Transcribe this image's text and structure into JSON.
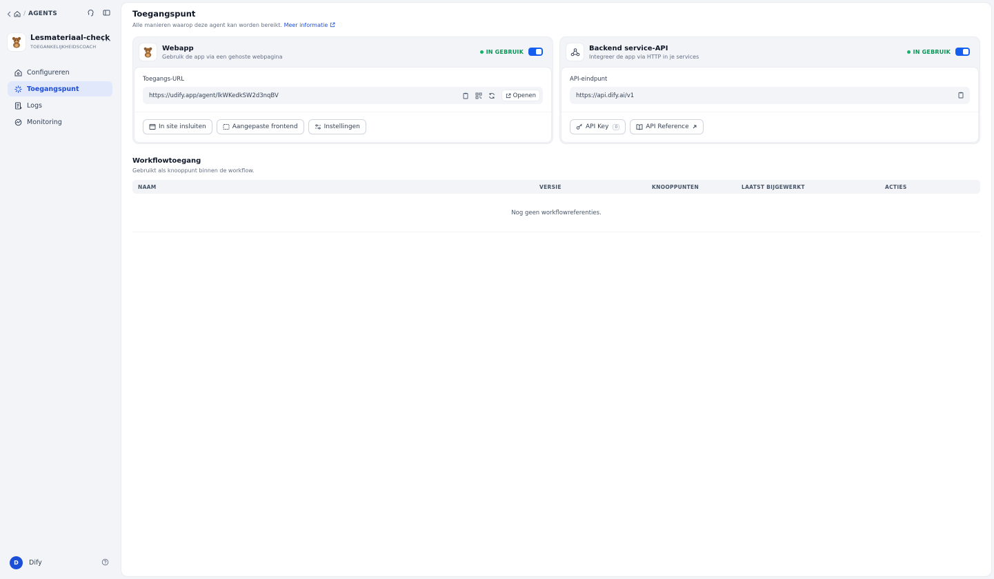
{
  "breadcrumb": {
    "section": "AGENTS"
  },
  "app": {
    "name": "Lesmateriaal-check",
    "subtitle": "TOEGANKELIJKHEIDSCOACH",
    "more": "···"
  },
  "nav": {
    "items": [
      {
        "label": "Configureren",
        "icon": "home-gear-icon"
      },
      {
        "label": "Toegangspunt",
        "icon": "access-point-icon",
        "active": true
      },
      {
        "label": "Logs",
        "icon": "logs-icon"
      },
      {
        "label": "Monitoring",
        "icon": "monitoring-icon"
      }
    ]
  },
  "user": {
    "initial": "D",
    "name": "Dify"
  },
  "page": {
    "title": "Toegangspunt",
    "subtitle": "Alle manieren waarop deze agent kan worden bereikt.",
    "more_link": "Meer informatie"
  },
  "webapp": {
    "title": "Webapp",
    "description": "Gebruik de app via een gehoste webpagina",
    "status": "IN GEBRUIK",
    "enabled": true,
    "field_label": "Toegangs-URL",
    "url": "https://udify.app/agent/lkWKedkSW2d3nqBV",
    "open_label": "Openen",
    "buttons": {
      "embed": "In site insluiten",
      "custom": "Aangepaste frontend",
      "settings": "Instellingen"
    }
  },
  "api": {
    "title": "Backend service-API",
    "description": "Integreer de app via HTTP in je services",
    "status": "IN GEBRUIK",
    "enabled": true,
    "field_label": "API-eindpunt",
    "url": "https://api.dify.ai/v1",
    "buttons": {
      "key": "API Key",
      "key_count": "0",
      "reference": "API Reference"
    }
  },
  "workflow": {
    "title": "Workflowtoegang",
    "subtitle": "Gebruikt als knooppunt binnen de workflow.",
    "columns": [
      "NAAM",
      "VERSIE",
      "KNOOPPUNTEN",
      "LAATST BIJGEWERKT",
      "ACTIES"
    ],
    "empty": "Nog geen workflowreferenties."
  },
  "colors": {
    "accent": "#1d4ed8",
    "toggle": "#155eef",
    "status": "#079455",
    "nav_active_bg": "#e2e8fb"
  }
}
